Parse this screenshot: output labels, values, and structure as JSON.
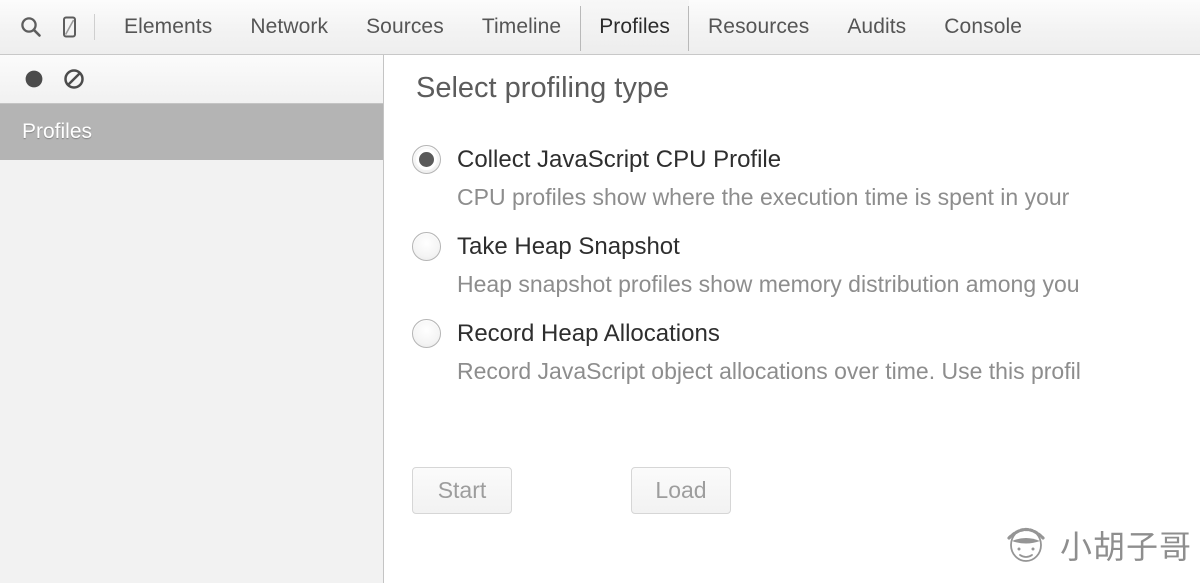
{
  "toolbar": {
    "inspect_icon": "search-icon",
    "device_icon": "device-toggle-icon",
    "tabs": [
      {
        "label": "Elements",
        "selected": false
      },
      {
        "label": "Network",
        "selected": false
      },
      {
        "label": "Sources",
        "selected": false
      },
      {
        "label": "Timeline",
        "selected": false
      },
      {
        "label": "Profiles",
        "selected": true
      },
      {
        "label": "Resources",
        "selected": false
      },
      {
        "label": "Audits",
        "selected": false
      },
      {
        "label": "Console",
        "selected": false
      }
    ]
  },
  "statusbar": {
    "record_icon": "record-circle-icon",
    "clear_icon": "clear-prohibition-icon"
  },
  "sidebar": {
    "items": [
      {
        "label": "Profiles",
        "selected": true
      }
    ]
  },
  "main": {
    "title": "Select profiling type",
    "options": [
      {
        "label": "Collect JavaScript CPU Profile",
        "description": "CPU profiles show where the execution time is spent in your",
        "checked": true
      },
      {
        "label": "Take Heap Snapshot",
        "description": "Heap snapshot profiles show memory distribution among you",
        "checked": false
      },
      {
        "label": "Record Heap Allocations",
        "description": "Record JavaScript object allocations over time. Use this profil",
        "checked": false
      }
    ],
    "buttons": {
      "start_label": "Start",
      "load_label": "Load"
    }
  },
  "watermark": {
    "text": "小胡子哥",
    "avatar_icon": "moustache-face-icon"
  },
  "colors": {
    "selected_sidebar_bg": "#b4b4b4",
    "panel_bg": "#ffffff",
    "sidebar_bg": "#f2f2f2",
    "toolbar_bg": "#f3f3f3",
    "title_text": "#5c5c5c",
    "desc_text": "#8d8d8d",
    "radio_dot": "#5a5a5a",
    "button_text": "#9d9d9d"
  }
}
